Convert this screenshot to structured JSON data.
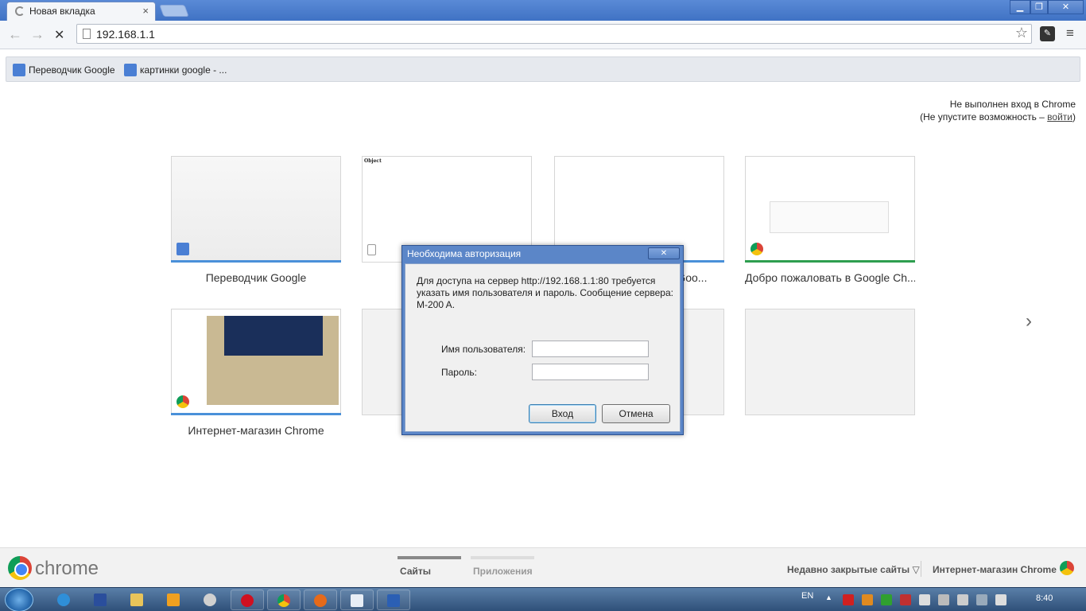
{
  "window": {
    "tab_title": "Новая вкладка",
    "tab_close": "×",
    "min_label": "▁",
    "max_label": "❐",
    "close_label": "✕"
  },
  "toolbar": {
    "back": "←",
    "forward": "→",
    "stop": "✕",
    "url": "192.168.1.1",
    "star": "☆",
    "menu": "≡"
  },
  "bookmarks": [
    {
      "label": "Переводчик Google",
      "color": "#4a7fd4"
    },
    {
      "label": "картинки google - ...",
      "color": "#4a7fd4"
    }
  ],
  "signin": {
    "line1": "Не выполнен вход в Chrome",
    "line2_prefix": "(Не упустите возможность – ",
    "line2_link": "войти",
    "line2_suffix": ")"
  },
  "thumbnails": [
    {
      "label": "Переводчик Google",
      "bar_color": "#4a90d9"
    },
    {
      "label": "",
      "mini_title": "Object",
      "bar_color": "#ffffff"
    },
    {
      "label": "в Goo...",
      "bar_color": "#4a90d9"
    },
    {
      "label": "Добро пожаловать в Google Ch...",
      "bar_color": "#2e9e4f"
    },
    {
      "label": "Интернет-магазин Chrome",
      "bar_color": "#4a90d9"
    }
  ],
  "next_arrow": "›",
  "dialog": {
    "title": "Необходима авторизация",
    "close": "✕",
    "message": "Для доступа на сервер http://192.168.1.1:80 требуется указать имя пользователя и пароль. Сообщение сервера: M-200 A.",
    "username_label": "Имя пользователя:",
    "password_label": "Пароль:",
    "username_value": "",
    "password_value": "",
    "ok_label": "Вход",
    "cancel_label": "Отмена"
  },
  "footer": {
    "brand": "chrome",
    "tab_sites": "Сайты",
    "tab_apps": "Приложения",
    "recently_closed": "Недавно закрытые сайты ▽",
    "webstore": "Интернет-магазин Chrome",
    "active_color": "#888888",
    "inactive_color": "#dddddd"
  },
  "taskbar": {
    "lang": "EN",
    "time": "8:40",
    "apps": [
      "ie-icon",
      "save-icon",
      "folder-icon",
      "media-icon",
      "paint-icon",
      "opera-icon",
      "chrome-icon",
      "firefox-icon",
      "notepad-icon",
      "word-icon"
    ]
  }
}
